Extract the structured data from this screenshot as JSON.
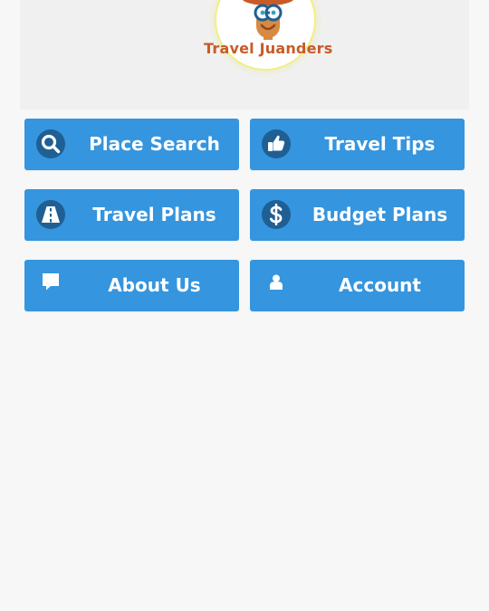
{
  "header": {
    "brand": "Travel Juanders",
    "logo_icon": "traveler-mascot-icon"
  },
  "menu": {
    "items": [
      {
        "label": "Place Search",
        "icon": "search-icon"
      },
      {
        "label": "Travel Tips",
        "icon": "thumbs-up-icon"
      },
      {
        "label": "Travel Plans",
        "icon": "road-icon"
      },
      {
        "label": "Budget Plans",
        "icon": "dollar-icon"
      },
      {
        "label": "About Us",
        "icon": "comment-icon"
      },
      {
        "label": "Account",
        "icon": "user-icon"
      }
    ]
  },
  "colors": {
    "button": "#3595de",
    "icon_circle": "#1f5f93",
    "brand_text": "#c85b27",
    "logo_glow": "#f2ee87"
  }
}
